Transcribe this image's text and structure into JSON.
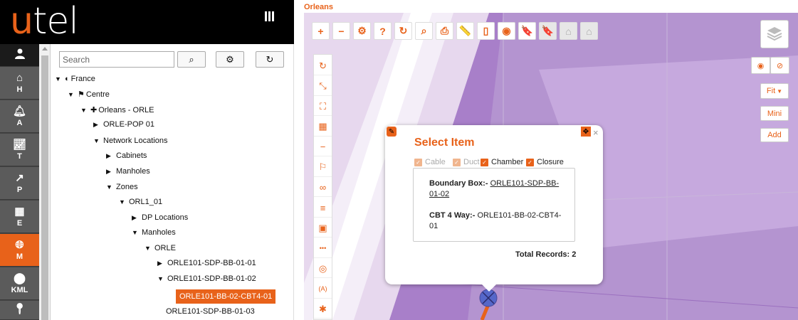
{
  "logo": {
    "first": "u",
    "rest": "tel"
  },
  "rail": [
    {
      "label": "",
      "icon": "user-icon"
    },
    {
      "label": "H",
      "icon": "home-icon"
    },
    {
      "label": "A",
      "icon": "bell-icon"
    },
    {
      "label": "T",
      "icon": "chart-icon"
    },
    {
      "label": "P",
      "icon": "share-icon"
    },
    {
      "label": "E",
      "icon": "chip-icon"
    },
    {
      "label": "M",
      "icon": "globe-icon"
    },
    {
      "label": "KML",
      "icon": "map-marker-icon"
    },
    {
      "label": "",
      "icon": "pin-icon"
    }
  ],
  "search": {
    "placeholder": "Search",
    "value": ""
  },
  "tree": [
    {
      "label": "France",
      "caret": "▼",
      "icon": "◐"
    },
    {
      "label": "Centre",
      "caret": "▼",
      "icon": "⚑"
    },
    {
      "label": "Orleans - ORLE",
      "caret": "▼",
      "icon": "✚"
    },
    {
      "label": "ORLE-POP 01",
      "caret": "▶",
      "icon": ""
    },
    {
      "label": "Network Locations",
      "caret": "▼",
      "icon": ""
    },
    {
      "label": "Cabinets",
      "caret": "▶",
      "icon": ""
    },
    {
      "label": "Manholes",
      "caret": "▶",
      "icon": ""
    },
    {
      "label": "Zones",
      "caret": "▼",
      "icon": ""
    },
    {
      "label": "ORL1_01",
      "caret": "▼",
      "icon": ""
    },
    {
      "label": "DP Locations",
      "caret": "▶",
      "icon": ""
    },
    {
      "label": "Manholes",
      "caret": "▼",
      "icon": ""
    },
    {
      "label": "ORLE",
      "caret": "▼",
      "icon": ""
    },
    {
      "label": "ORLE101-SDP-BB-01-01",
      "caret": "▶",
      "icon": ""
    },
    {
      "label": "ORLE101-SDP-BB-01-02",
      "caret": "▼",
      "icon": ""
    },
    {
      "label": "ORLE101-BB-02-CBT4-01",
      "caret": "",
      "icon": ""
    },
    {
      "label": "ORLE101-SDP-BB-01-03",
      "caret": "",
      "icon": ""
    }
  ],
  "map": {
    "title": "Orleans",
    "toolbar": [
      "+",
      "−",
      "⚙",
      "?",
      "↻",
      "⌕",
      "⎙",
      "📏",
      "▯",
      "◉",
      "🔖",
      "🔖",
      "⌂",
      "⌂"
    ],
    "tools": [
      "↻",
      "⤡",
      "⛶",
      "▦",
      "−",
      "⚐",
      "∞",
      "≡",
      "▣",
      "•••",
      "◎",
      "(A)",
      "✱"
    ],
    "fit_label": "Fit",
    "mini_label": "Mini",
    "add_label": "Add"
  },
  "popup": {
    "title": "Select Item",
    "filters": [
      {
        "label": "Cable",
        "checked": true,
        "dim": true
      },
      {
        "label": "Duct",
        "checked": true,
        "dim": true
      },
      {
        "label": "Chamber",
        "checked": true,
        "dim": false
      },
      {
        "label": "Closure",
        "checked": true,
        "dim": false
      }
    ],
    "records": [
      {
        "label": "Boundary Box:-",
        "value": "ORLE101-SDP-BB-01-02"
      },
      {
        "label": "CBT 4 Way:-",
        "value": "ORLE101-BB-02-CBT4-01"
      }
    ],
    "total": "Total Records: 2"
  },
  "colors": {
    "accent": "#e8621a",
    "map_base": "#a87fc9"
  }
}
